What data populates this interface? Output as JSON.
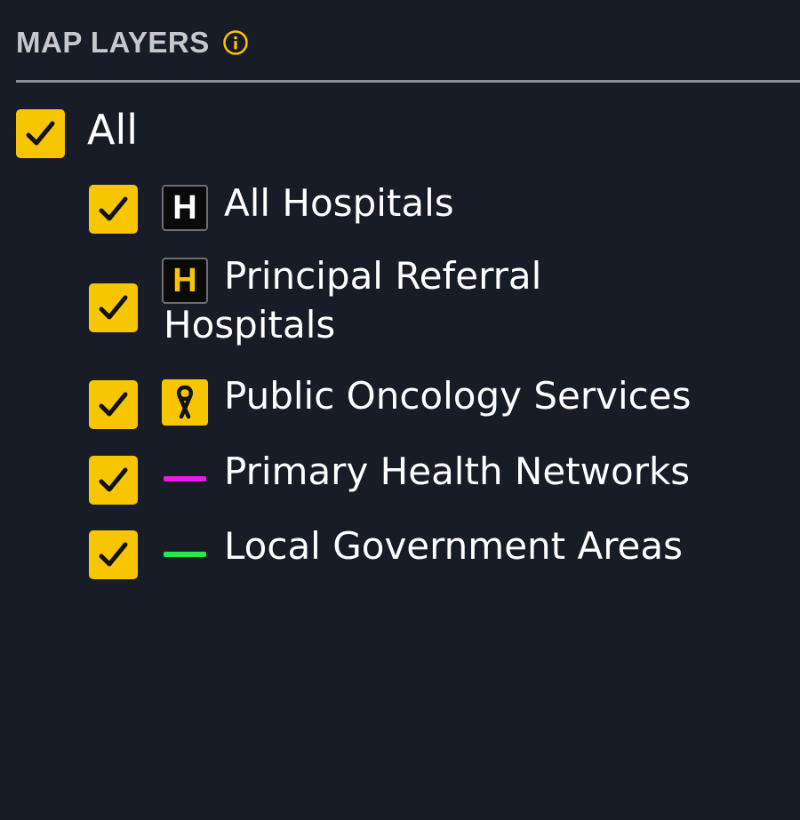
{
  "panel": {
    "title": "MAP LAYERS",
    "info_icon": "info-circle-icon"
  },
  "colors": {
    "background": "#181c27",
    "accent": "#f7c600",
    "title": "#c8c8cc",
    "divider": "#8c8f96",
    "primary_health_networks_line": "#e81be8",
    "local_government_areas_line": "#27e84a"
  },
  "layers": {
    "all": {
      "label": "All",
      "checked": true
    },
    "items": [
      {
        "label": "All Hospitals",
        "icon": "hospital-h-white-icon",
        "checked": true
      },
      {
        "label_line1": "Principal Referral",
        "label_line2": "Hospitals",
        "icon": "hospital-h-yellow-icon",
        "checked": true
      },
      {
        "label": "Public Oncology Services",
        "icon": "awareness-ribbon-icon",
        "checked": true
      },
      {
        "label": "Primary Health Networks",
        "icon": "magenta-line-icon",
        "checked": true
      },
      {
        "label": "Local Government Areas",
        "icon": "green-line-icon",
        "checked": true
      }
    ]
  },
  "icon_text": {
    "hospital_letter": "H"
  }
}
